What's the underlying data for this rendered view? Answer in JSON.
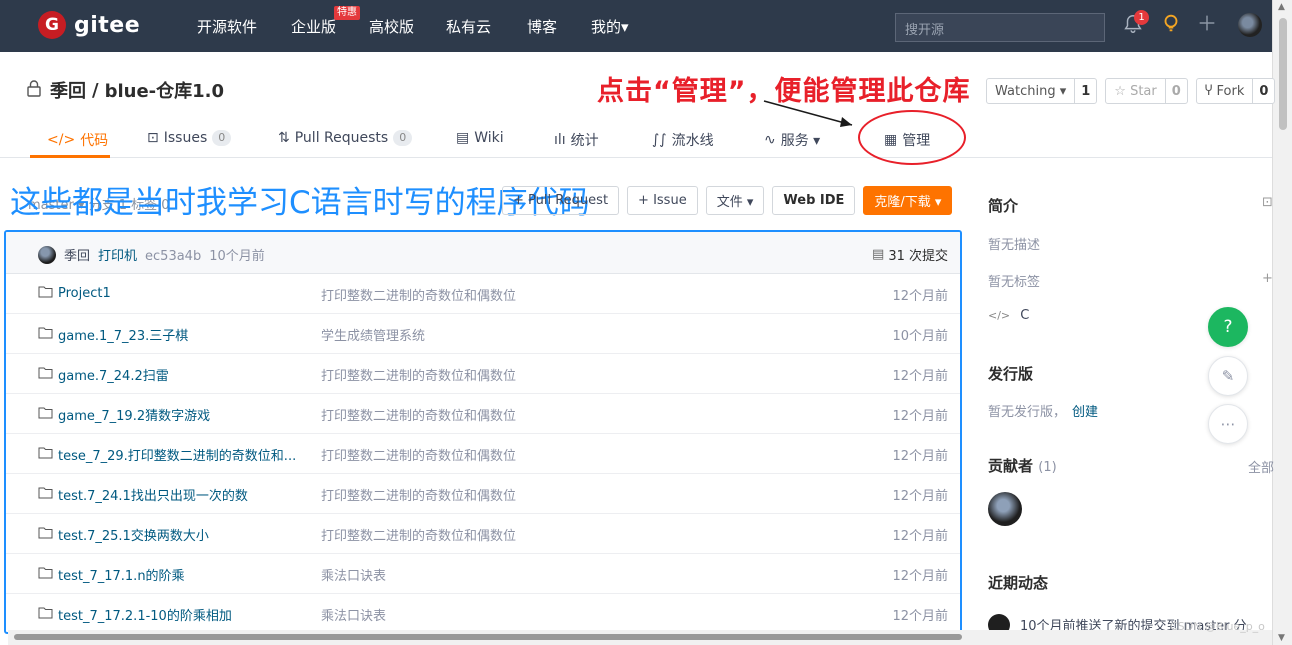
{
  "nav": {
    "logo_letter": "G",
    "logo_text": "gitee",
    "items": [
      "开源软件",
      "企业版",
      "高校版",
      "私有云",
      "博客",
      "我的▾"
    ],
    "hot_badge": "特惠",
    "search_placeholder": "搜开源",
    "notify_count": "1"
  },
  "repo": {
    "owner": "季回",
    "sep": "/",
    "name": "blue-仓库1.0",
    "watch_label": "Watching ▾",
    "watch_count": "1",
    "star_label": "☆ Star",
    "star_count": "0",
    "fork_label": "Fork",
    "fork_count": "0"
  },
  "annotations": {
    "red": "点击“管理”，便能管理此仓库",
    "blue": "这些都是当时我学习C语言时写的程序代码"
  },
  "tabs": [
    {
      "label": "代码",
      "icon": "code-icon"
    },
    {
      "label": "Issues",
      "count": "0",
      "icon": "issue-icon"
    },
    {
      "label": "Pull Requests",
      "count": "0",
      "icon": "pr-icon"
    },
    {
      "label": "Wiki",
      "icon": "wiki-icon"
    },
    {
      "label": "统计",
      "icon": "chart-icon"
    },
    {
      "label": "流水线",
      "icon": "pipeline-icon"
    },
    {
      "label": "服务 ▾",
      "icon": "pulse-icon"
    },
    {
      "label": "管理",
      "icon": "manage-icon"
    }
  ],
  "toolbar": {
    "ghost": "master ▾  分支 1   标签 0",
    "pr": "+ Pull Request",
    "issue": "+ Issue",
    "files": "文件 ▾",
    "webide": "Web IDE",
    "clone": "克隆/下载 ▾"
  },
  "commit": {
    "author": "季回",
    "message": "打印机",
    "hash": "ec53a4b",
    "time": "10个月前",
    "total": "31 次提交"
  },
  "files": [
    {
      "name": "Project1",
      "msg": "打印整数二进制的奇数位和偶数位",
      "time": "12个月前"
    },
    {
      "name": "game.1_7_23.三子棋",
      "msg": "学生成绩管理系统",
      "time": "10个月前"
    },
    {
      "name": "game.7_24.2扫雷",
      "msg": "打印整数二进制的奇数位和偶数位",
      "time": "12个月前"
    },
    {
      "name": "game_7_19.2猜数字游戏",
      "msg": "打印整数二进制的奇数位和偶数位",
      "time": "12个月前"
    },
    {
      "name": "tese_7_29.打印整数二进制的奇数位和...",
      "msg": "打印整数二进制的奇数位和偶数位",
      "time": "12个月前"
    },
    {
      "name": "test.7_24.1找出只出现一次的数",
      "msg": "打印整数二进制的奇数位和偶数位",
      "time": "12个月前"
    },
    {
      "name": "test.7_25.1交换两数大小",
      "msg": "打印整数二进制的奇数位和偶数位",
      "time": "12个月前"
    },
    {
      "name": "test_7_17.1.n的阶乘",
      "msg": "乘法口诀表",
      "time": "12个月前"
    },
    {
      "name": "test_7_17.2.1-10的阶乘相加",
      "msg": "乘法口诀表",
      "time": "12个月前"
    }
  ],
  "sidebar": {
    "intro_title": "简介",
    "intro_text": "暂无描述",
    "tags_text": "暂无标签",
    "lang": "C",
    "release_title": "发行版",
    "release_text": "暂无发行版，",
    "release_link": "创建",
    "contrib_title": "贡献者",
    "contrib_count": "(1)",
    "contrib_all": "全部",
    "recent_title": "近期动态",
    "recent_text": "10个月前推送了新的提交到 master 分"
  },
  "float": {
    "help": "?"
  },
  "watermark": "CSDN @Blue_p_o"
}
